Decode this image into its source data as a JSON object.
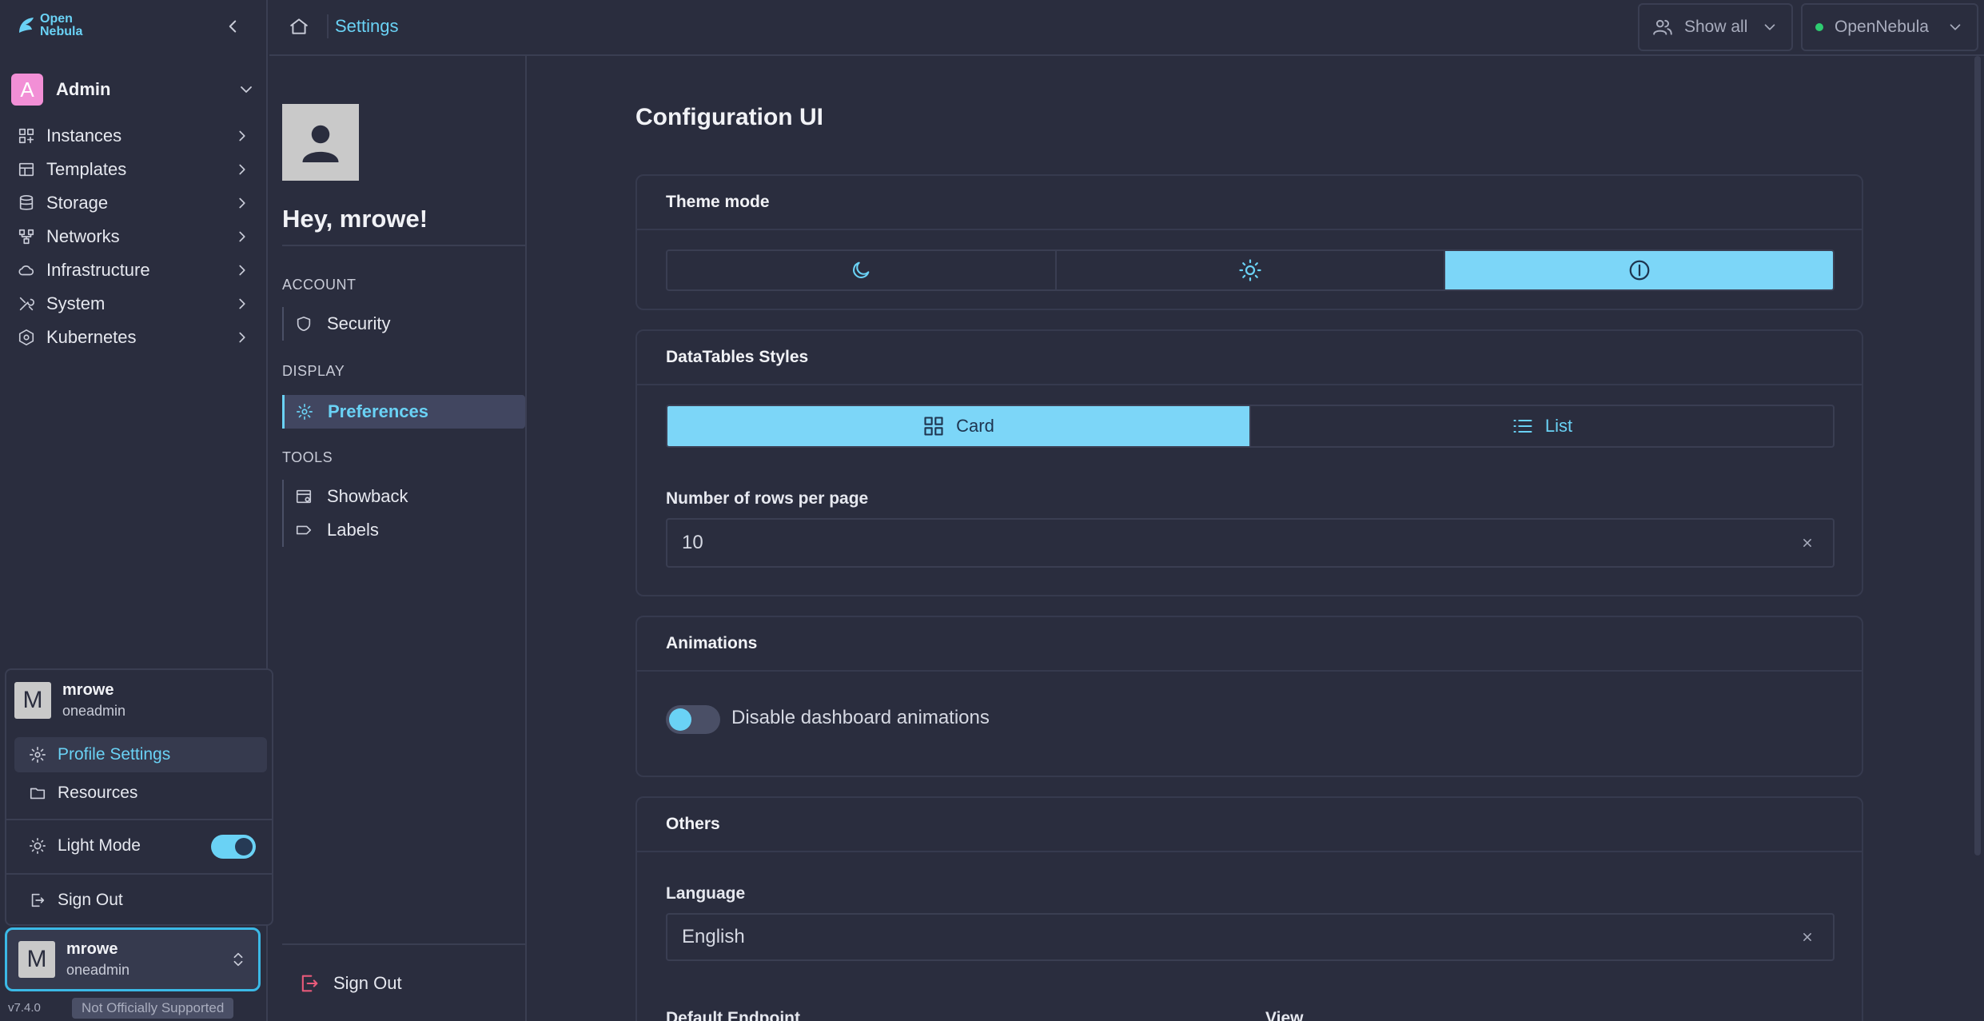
{
  "app": {
    "logo_text_1": "Open",
    "logo_text_2": "Nebula"
  },
  "sidebar": {
    "group": {
      "avatar": "A",
      "name": "Admin"
    },
    "items": [
      {
        "label": "Instances",
        "icon": "instances-icon"
      },
      {
        "label": "Templates",
        "icon": "templates-icon"
      },
      {
        "label": "Storage",
        "icon": "storage-icon"
      },
      {
        "label": "Networks",
        "icon": "networks-icon"
      },
      {
        "label": "Infrastructure",
        "icon": "cloud-icon"
      },
      {
        "label": "System",
        "icon": "system-icon"
      },
      {
        "label": "Kubernetes",
        "icon": "kubernetes-icon"
      }
    ],
    "version": "v7.4.0",
    "support_badge": "Not Officially Supported"
  },
  "user_menu": {
    "avatar": "M",
    "name": "mrowe",
    "group": "oneadmin",
    "profile_settings": "Profile Settings",
    "resources": "Resources",
    "light_mode": "Light Mode",
    "light_mode_on": true,
    "sign_out": "Sign Out"
  },
  "user_card": {
    "avatar": "M",
    "name": "mrowe",
    "group": "oneadmin"
  },
  "topbar": {
    "page_title": "Settings",
    "filter_label": "Show all",
    "zone_label": "OpenNebula",
    "zone_status_color": "#2ecc71"
  },
  "settings": {
    "greeting": "Hey, mrowe!",
    "sections": {
      "account": "ACCOUNT",
      "display": "DISPLAY",
      "tools": "TOOLS"
    },
    "items": {
      "security": "Security",
      "preferences": "Preferences",
      "showback": "Showback",
      "labels": "Labels"
    },
    "sign_out": "Sign Out"
  },
  "content": {
    "title": "Configuration UI",
    "theme_mode": {
      "title": "Theme mode",
      "options": [
        "dark",
        "light",
        "system"
      ],
      "selected": "system"
    },
    "datatables": {
      "title": "DataTables Styles",
      "card_label": "Card",
      "list_label": "List",
      "selected": "Card",
      "rows_label": "Number of rows per page",
      "rows_value": "10"
    },
    "animations": {
      "title": "Animations",
      "toggle_label": "Disable dashboard animations",
      "toggle_on": false
    },
    "others": {
      "title": "Others",
      "language_label": "Language",
      "language_value": "English",
      "endpoint_label": "Default Endpoint",
      "view_label": "View"
    }
  },
  "colors": {
    "accent": "#6ad2f5",
    "background": "#2a2d3e",
    "danger": "#e85a7a"
  }
}
